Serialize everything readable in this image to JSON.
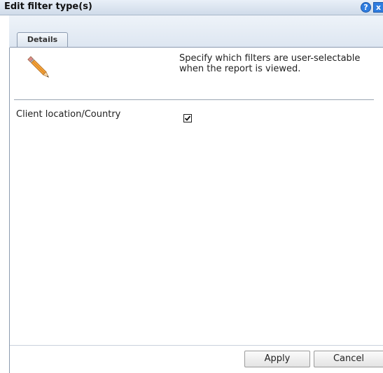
{
  "dialog": {
    "title": "Edit filter type(s)",
    "help_icon": "?",
    "close_icon": "x"
  },
  "tabs": [
    {
      "label": "Details"
    }
  ],
  "details": {
    "description": "Specify which filters are user-selectable when the report is viewed.",
    "fields": [
      {
        "label": "Client location/Country",
        "checked": true
      }
    ]
  },
  "buttons": {
    "apply": "Apply",
    "cancel": "Cancel"
  },
  "colors": {
    "titlebar": "#cfdbe9",
    "accent": "#2f7de0",
    "border": "#8c9bb0"
  }
}
